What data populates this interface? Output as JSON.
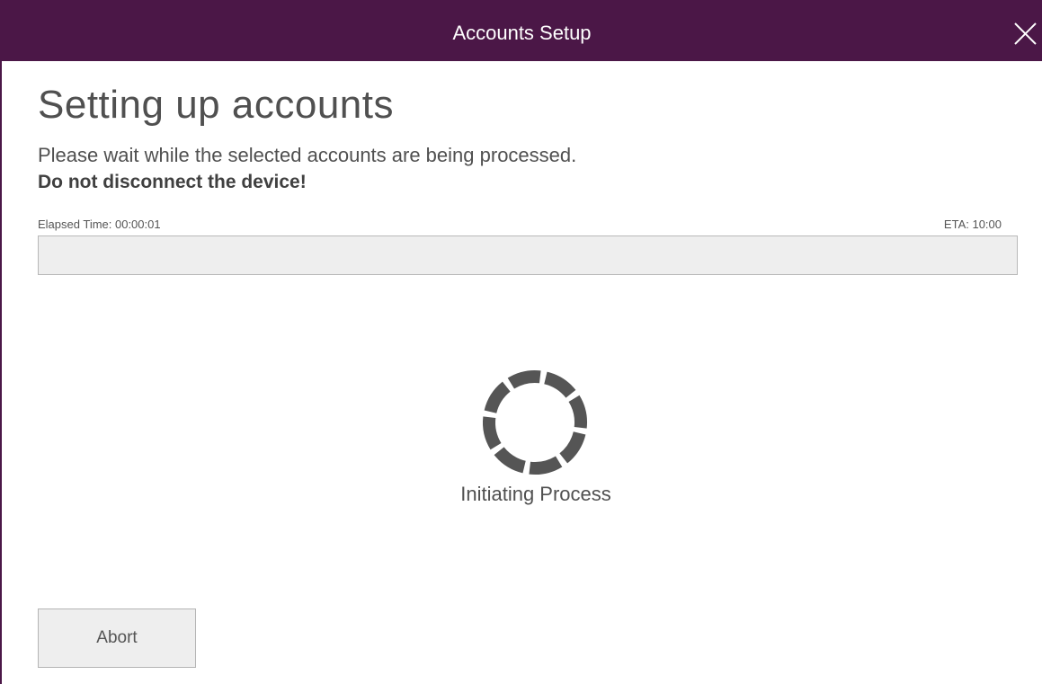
{
  "window": {
    "title": "Accounts Setup",
    "close_icon": "close-icon",
    "accent_color": "#4b1747"
  },
  "main": {
    "heading": "Setting up accounts",
    "subtitle": "Please wait while the selected accounts are being processed.",
    "warning": "Do not disconnect the device!"
  },
  "progress": {
    "elapsed_label": "Elapsed Time: 00:00:01",
    "eta_label": "ETA: 10:00",
    "value_percent": 0
  },
  "status": {
    "spinner_icon": "loading-spinner-icon",
    "text": "Initiating Process"
  },
  "footer": {
    "abort_label": "Abort"
  }
}
